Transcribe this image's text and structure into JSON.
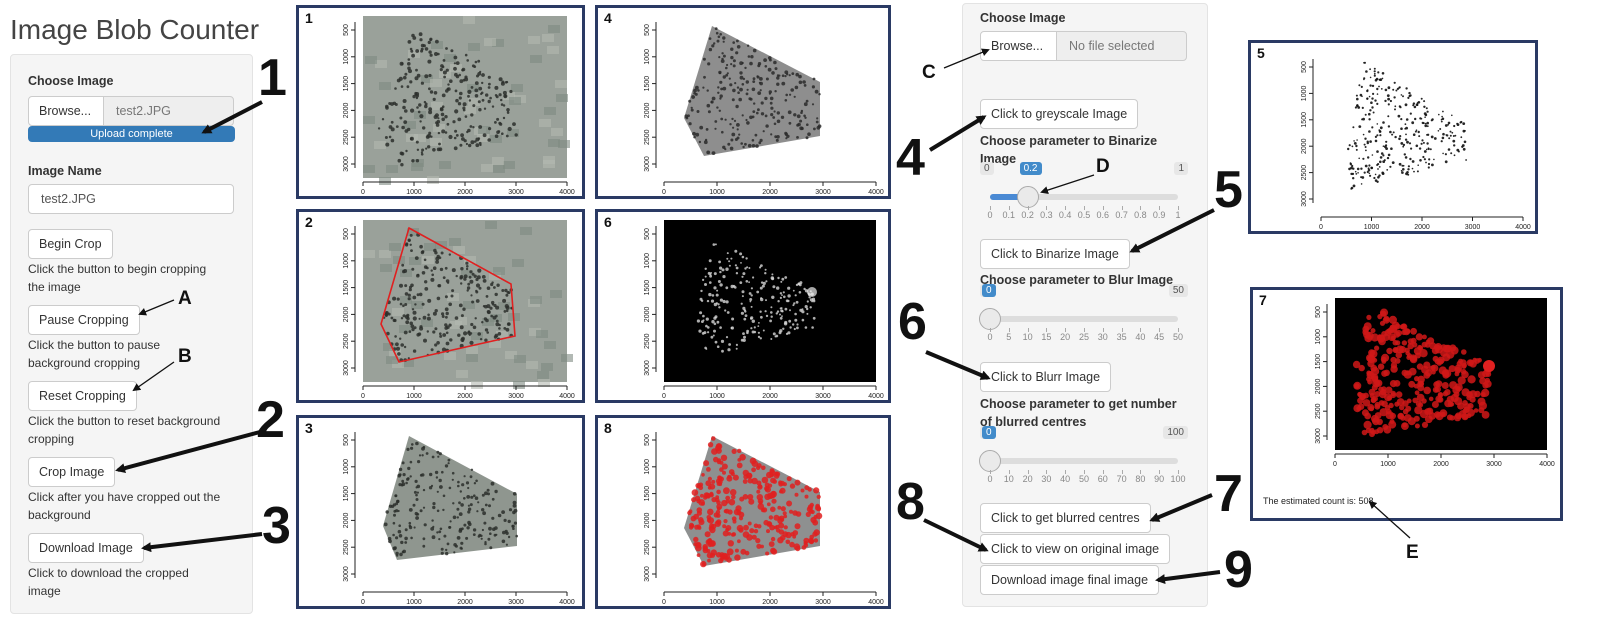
{
  "app_title": "Image Blob Counter",
  "left_panel": {
    "choose_image_label": "Choose Image",
    "browse_label": "Browse...",
    "file_name": "test2.JPG",
    "upload_status": "Upload complete",
    "upload_progress_percent": 100,
    "image_name_label": "Image Name",
    "image_name_value": "test2.JPG",
    "begin_crop_label": "Begin Crop",
    "begin_crop_help": [
      "Click the button to begin cropping",
      "the image"
    ],
    "pause_label": "Pause Cropping",
    "pause_help": [
      "Click the button to pause",
      "background cropping"
    ],
    "reset_label": "Reset Cropping",
    "reset_help": [
      "Click the button to reset background",
      "cropping"
    ],
    "crop_label": "Crop Image",
    "crop_help": [
      "Click after you have cropped out the",
      "background"
    ],
    "download_label": "Download Image",
    "download_help": [
      "Click to download the cropped",
      "image"
    ]
  },
  "right_panel": {
    "choose_image_label": "Choose Image",
    "browse_label": "Browse...",
    "file_placeholder": "No file selected",
    "greyscale_label": "Click to greyscale Image",
    "binarize_param_label": [
      "Choose parameter to Binarize",
      "Image"
    ],
    "binarize_slider": {
      "min": "0",
      "max": "1",
      "value": "0.2",
      "value_num": 0.2,
      "ticks": [
        "0",
        "0.1",
        "0.2",
        "0.3",
        "0.4",
        "0.5",
        "0.6",
        "0.7",
        "0.8",
        "0.9",
        "1"
      ]
    },
    "binarize_label": "Click to Binarize Image",
    "blur_param_label": "Choose parameter to Blur Image",
    "blur_slider": {
      "min": "0",
      "max": "50",
      "value": "0",
      "value_num": 0,
      "ticks": [
        "0",
        "5",
        "10",
        "15",
        "20",
        "25",
        "30",
        "35",
        "40",
        "45",
        "50"
      ]
    },
    "blur_label": "Click to Blurr Image",
    "centres_param_label": [
      "Choose parameter to get number",
      "of blurred centres"
    ],
    "centres_slider": {
      "min": "0",
      "max": "100",
      "value": "0",
      "value_num": 0,
      "ticks": [
        "0",
        "10",
        "20",
        "30",
        "40",
        "50",
        "60",
        "70",
        "80",
        "90",
        "100"
      ]
    },
    "centres_label": "Click to get blurred centres",
    "view_original_label": "Click to view on original image",
    "download_final_label": "Download image final image"
  },
  "plots": {
    "y_ticks": [
      "500",
      "1000",
      "1500",
      "2000",
      "2500",
      "3000"
    ],
    "x_ticks": [
      "0",
      "1000",
      "2000",
      "3000",
      "4000"
    ],
    "panel_1": "1",
    "panel_2": "2",
    "panel_3": "3",
    "panel_4": "4",
    "panel_5": "5",
    "panel_6": "6",
    "panel_7": "7",
    "panel_8": "8",
    "estimated_count_text": "The estimated count is: 508"
  },
  "annotations": {
    "n1": "1",
    "n2": "2",
    "n3": "3",
    "n4": "4",
    "n5": "5",
    "n6": "6",
    "n7": "7",
    "n8": "8",
    "n9": "9",
    "A": "A",
    "B": "B",
    "C": "C",
    "D": "D",
    "E": "E"
  },
  "colors": {
    "accent": "#337ab7",
    "frame": "#2a3a64",
    "blob_red": "#e02020"
  }
}
